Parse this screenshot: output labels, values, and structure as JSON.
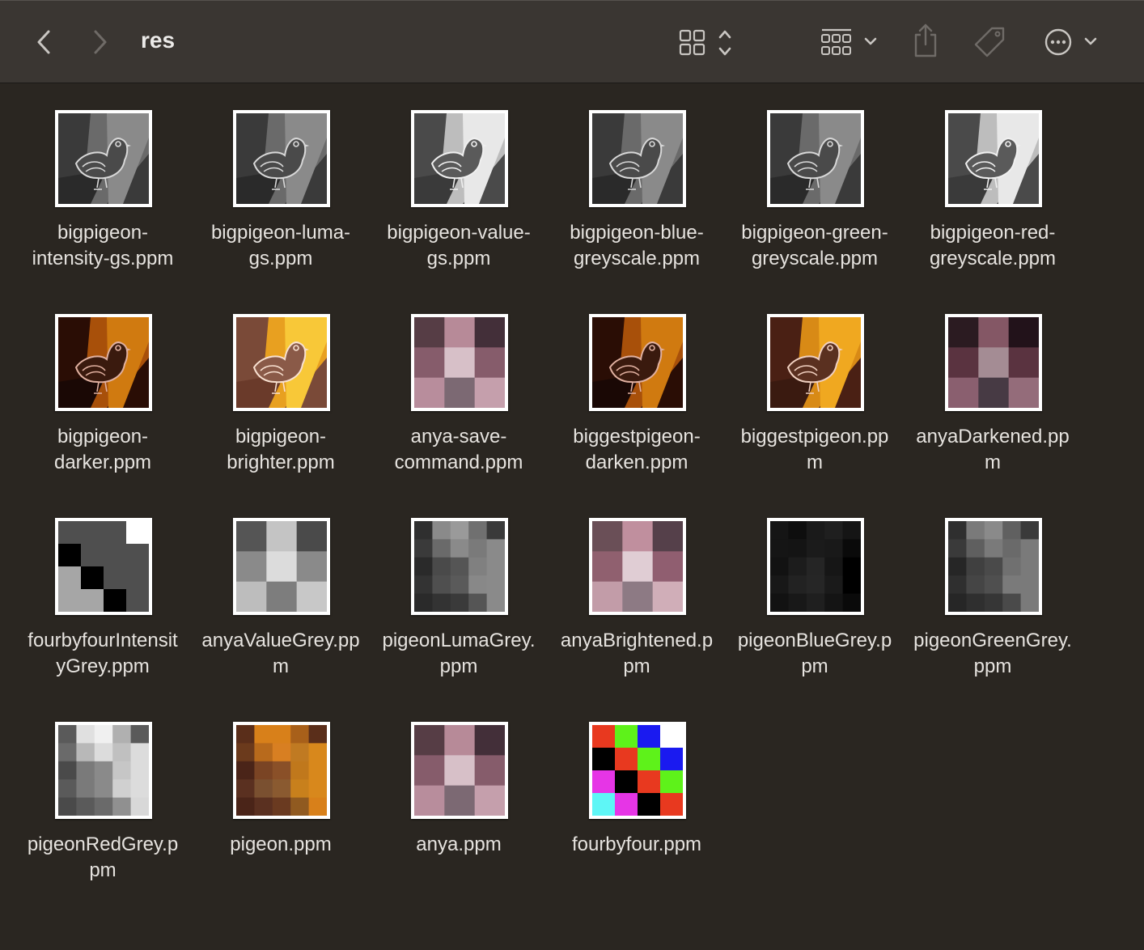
{
  "window": {
    "title": "res"
  },
  "toolbar": {
    "back": "chevron-left-icon",
    "forward": "chevron-right-icon",
    "view": "grid-view-icon",
    "group": "group-by-icon",
    "share": "share-icon",
    "tag": "tag-icon",
    "more": "ellipsis-circle-icon"
  },
  "files": [
    {
      "name": "bigpigeon-\nintensity-gs.ppm",
      "thumb": "pigeon-gray"
    },
    {
      "name": "bigpigeon-luma-\ngs.ppm",
      "thumb": "pigeon-gray"
    },
    {
      "name": "bigpigeon-value-\ngs.ppm",
      "thumb": "pigeon-light"
    },
    {
      "name": "bigpigeon-blue-\ngreyscale.ppm",
      "thumb": "pigeon-gray"
    },
    {
      "name": "bigpigeon-green-\ngreyscale.ppm",
      "thumb": "pigeon-gray"
    },
    {
      "name": "bigpigeon-red-\ngreyscale.ppm",
      "thumb": "pigeon-light"
    },
    {
      "name": "bigpigeon-\ndarker.ppm",
      "thumb": "pigeon-dark"
    },
    {
      "name": "bigpigeon-\nbrighter.ppm",
      "thumb": "pigeon-bright"
    },
    {
      "name": "anya-save-\ncommand.ppm",
      "thumb": "grid3-anya"
    },
    {
      "name": "biggestpigeon-\ndarken.ppm",
      "thumb": "pigeon-dark"
    },
    {
      "name": "biggestpigeon.pp\nm",
      "thumb": "pigeon-color"
    },
    {
      "name": "anyaDarkened.pp\nm",
      "thumb": "grid3-anya-dark"
    },
    {
      "name": "fourbyfourIntensit\nyGrey.ppm",
      "thumb": "grid4-fbf-grey"
    },
    {
      "name": "anyaValueGrey.pp\nm",
      "thumb": "grid3-anya-grey"
    },
    {
      "name": "pigeonLumaGrey.\nppm",
      "thumb": "grid5-pigeon-luma"
    },
    {
      "name": "anyaBrightened.p\npm",
      "thumb": "grid3-anya-bright"
    },
    {
      "name": "pigeonBlueGrey.p\npm",
      "thumb": "grid5-pigeon-blue"
    },
    {
      "name": "pigeonGreenGrey.\nppm",
      "thumb": "grid5-pigeon-green"
    },
    {
      "name": "pigeonRedGrey.p\npm",
      "thumb": "grid5-pigeon-red"
    },
    {
      "name": "pigeon.ppm",
      "thumb": "grid5-pigeon"
    },
    {
      "name": "anya.ppm",
      "thumb": "grid3-anya"
    },
    {
      "name": "fourbyfour.ppm",
      "thumb": "grid4-fbf"
    }
  ]
}
